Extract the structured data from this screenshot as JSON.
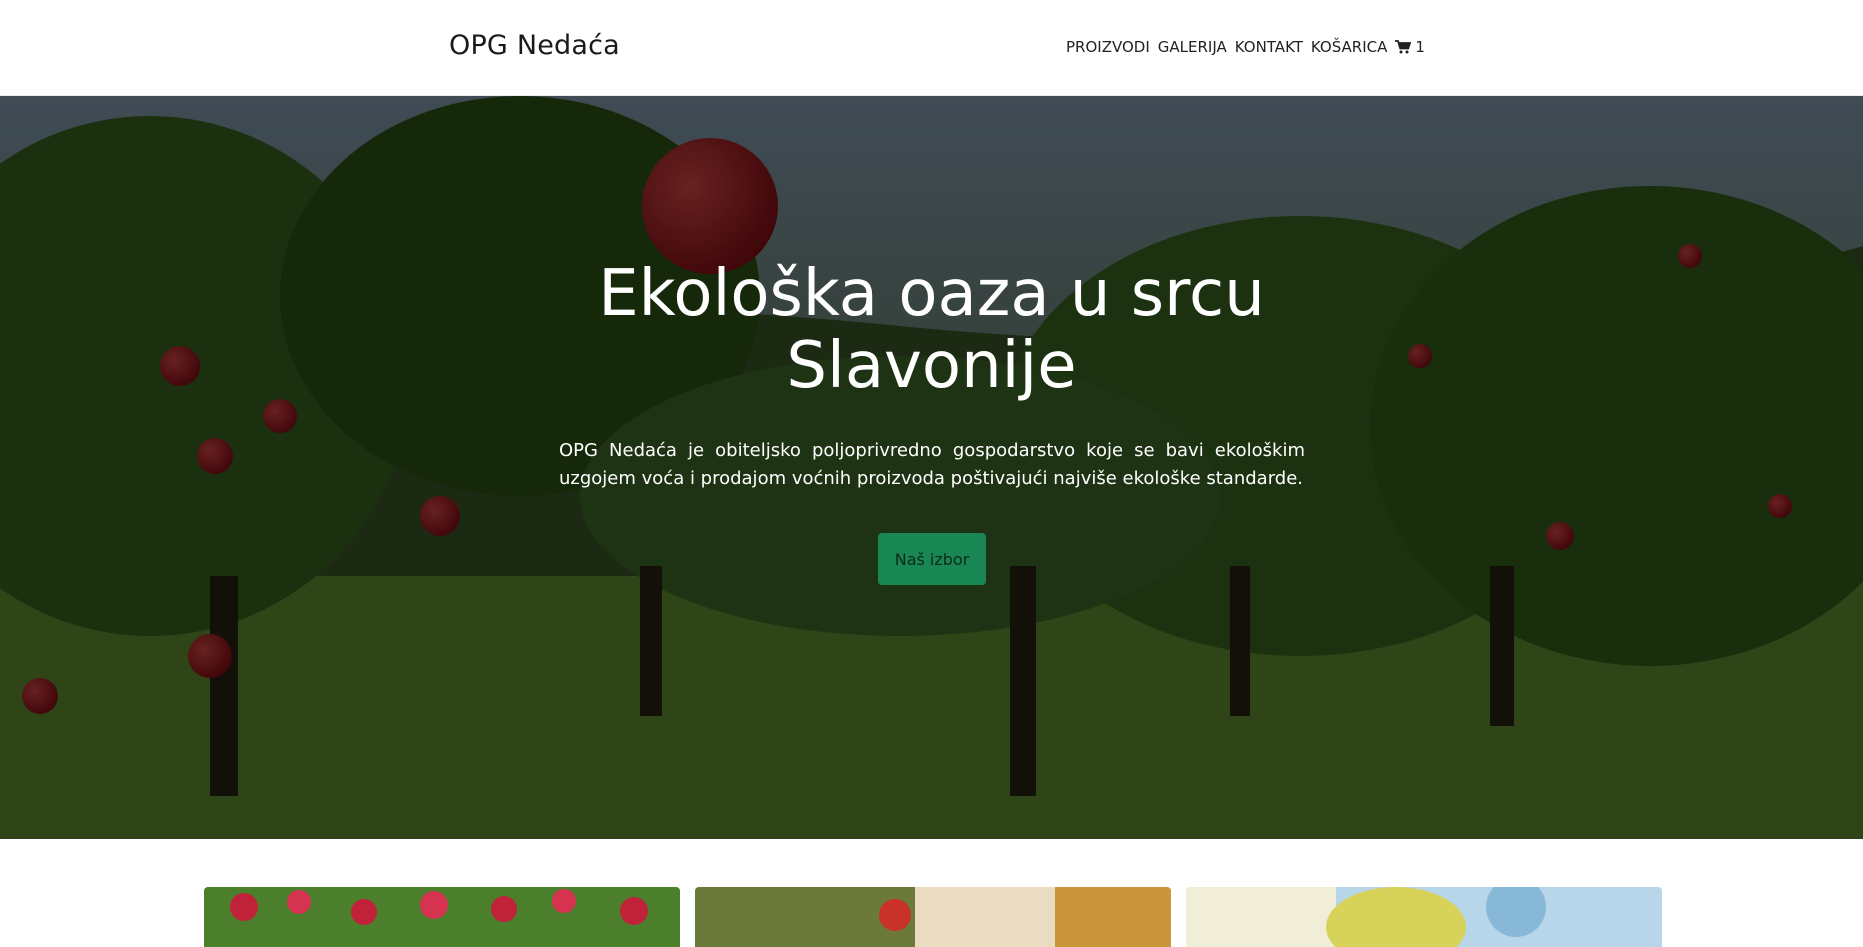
{
  "header": {
    "brand": "OPG Nedaća",
    "nav": [
      {
        "label": "PROIZVODI"
      },
      {
        "label": "GALERIJA"
      },
      {
        "label": "KONTAKT"
      },
      {
        "label": "KOŠARICA"
      }
    ],
    "cart_count": "1",
    "cart_icon": "cart-icon"
  },
  "hero": {
    "title": "Ekološka oaza u srcu Slavonije",
    "text": "OPG Nedaća je obiteljsko poljoprivredno gospodarstvo koje se bavi ekološkim uzgojem voća i prodajom voćnih proizvoda poštivajući najviše ekološke standarde.",
    "button_label": "Naš izbor",
    "button_color": "#198754"
  },
  "cards": [
    {
      "image": "apples-on-tree"
    },
    {
      "image": "apple-orchard-sunlight"
    },
    {
      "image": "pear-on-branch"
    }
  ]
}
